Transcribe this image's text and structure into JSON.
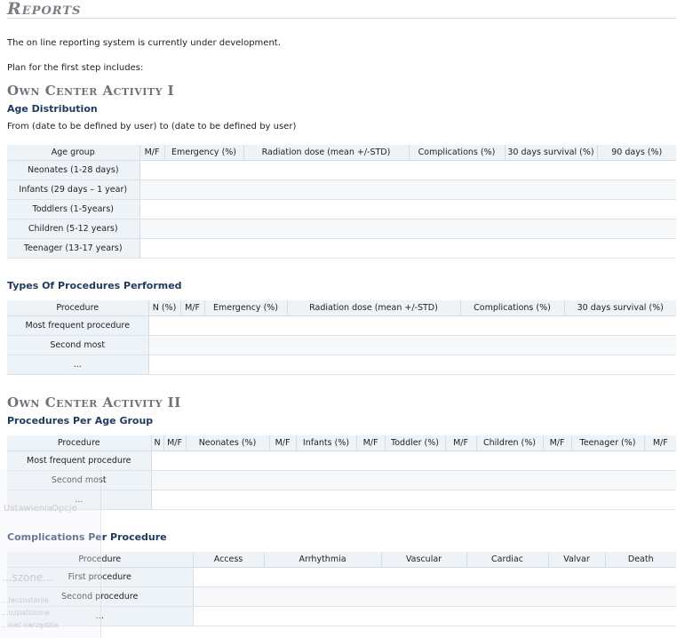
{
  "page": {
    "title": "Reports",
    "intro": "The on line reporting system is currently under development.",
    "plan": "Plan for the first step includes:"
  },
  "activity1": {
    "title": "Own Center Activity I",
    "age_distribution": {
      "subtitle": "Age Distribution",
      "range_text": "From (date to be defined by user) to (date to be defined by user)",
      "headers": [
        "Age group",
        "M/F",
        "Emergency (%)",
        "Radiation dose (mean +/-STD)",
        "Complications (%)",
        "30 days survival (%)",
        "90 days (%)"
      ],
      "rows": [
        "Neonates (1-28 days)",
        "Infants (29 days – 1 year)",
        "Toddlers (1-5years)",
        "Children (5-12 years)",
        "Teenager (13-17 years)"
      ]
    },
    "procedures": {
      "subtitle": "Types Of Procedures Performed",
      "headers": [
        "Procedure",
        "N (%)",
        "M/F",
        "Emergency (%)",
        "Radiation dose (mean +/-STD)",
        "Complications (%)",
        "30 days survival (%)"
      ],
      "rows": [
        "Most frequent procedure",
        "Second most",
        "..."
      ]
    }
  },
  "activity2": {
    "title": "Own Center Activity II",
    "per_age": {
      "subtitle": "Procedures Per Age Group",
      "headers": [
        "Procedure",
        "N",
        "M/F",
        "Neonates (%)",
        "M/F",
        "Infants (%)",
        "M/F",
        "Toddler (%)",
        "M/F",
        "Children (%)",
        "M/F",
        "Teenager (%)",
        "M/F"
      ],
      "rows": [
        "Most frequent procedure",
        "Second most",
        "..."
      ]
    },
    "complications": {
      "subtitle": "Complications Per Procedure",
      "headers": [
        "Procedure",
        "Access",
        "Arrhythmia",
        "Vascular",
        "Cardiac",
        "Valvar",
        "Death"
      ],
      "rows": [
        "First procedure",
        "Second procedure",
        "..."
      ]
    }
  },
  "overlay": {
    "items": [
      "Ustawienia",
      "Opcje",
      "...szone...",
      "...ieczostanie",
      "...ozpatozone",
      "...nać narzędzia"
    ]
  }
}
